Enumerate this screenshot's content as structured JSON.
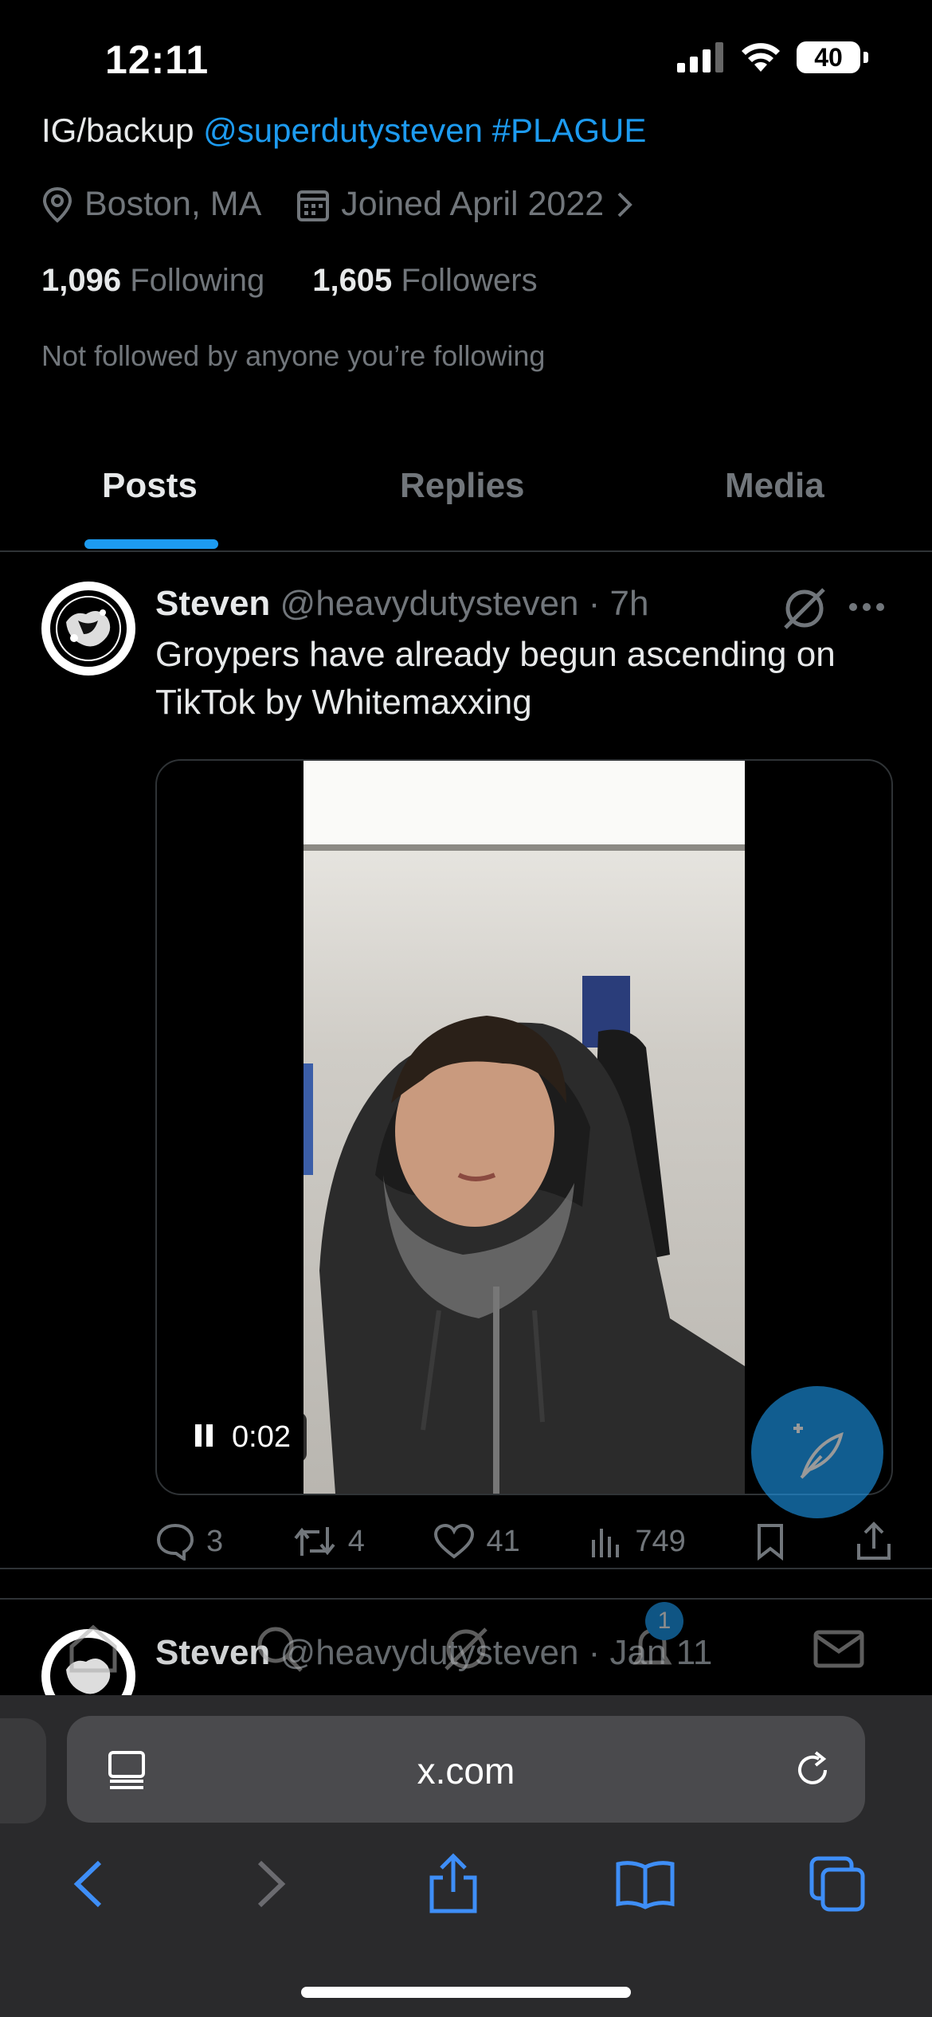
{
  "status_bar": {
    "time": "12:11",
    "battery": "40"
  },
  "profile": {
    "bio_prefix": "IG/backup ",
    "bio_mention": "@superdutysteven",
    "bio_hashtag": "#PLAGUE",
    "location": "Boston, MA",
    "joined": "Joined April 2022",
    "following_count": "1,096",
    "following_label": "Following",
    "followers_count": "1,605",
    "followers_label": "Followers",
    "not_followed_text": "Not followed by anyone you’re following"
  },
  "tabs": [
    {
      "label": "Posts",
      "selected": true
    },
    {
      "label": "Replies",
      "selected": false
    },
    {
      "label": "Media",
      "selected": false
    }
  ],
  "post": {
    "name": "Steven",
    "handle": "@heavydutysteven",
    "time": "· 7h",
    "text": "Groypers have already begun ascending on TikTok by Whitemaxxing",
    "video_time": "0:02",
    "replies": "3",
    "reposts": "4",
    "likes": "41",
    "views": "749"
  },
  "post2": {
    "name": "Steven",
    "handle": "@heavydutysteven",
    "time": "· Jan 11"
  },
  "bottom_nav": {
    "notifications_badge": "1"
  },
  "browser": {
    "url": "x.com"
  },
  "colors": {
    "accent": "#1d9bf0",
    "muted": "#71767b",
    "background": "#000000"
  }
}
